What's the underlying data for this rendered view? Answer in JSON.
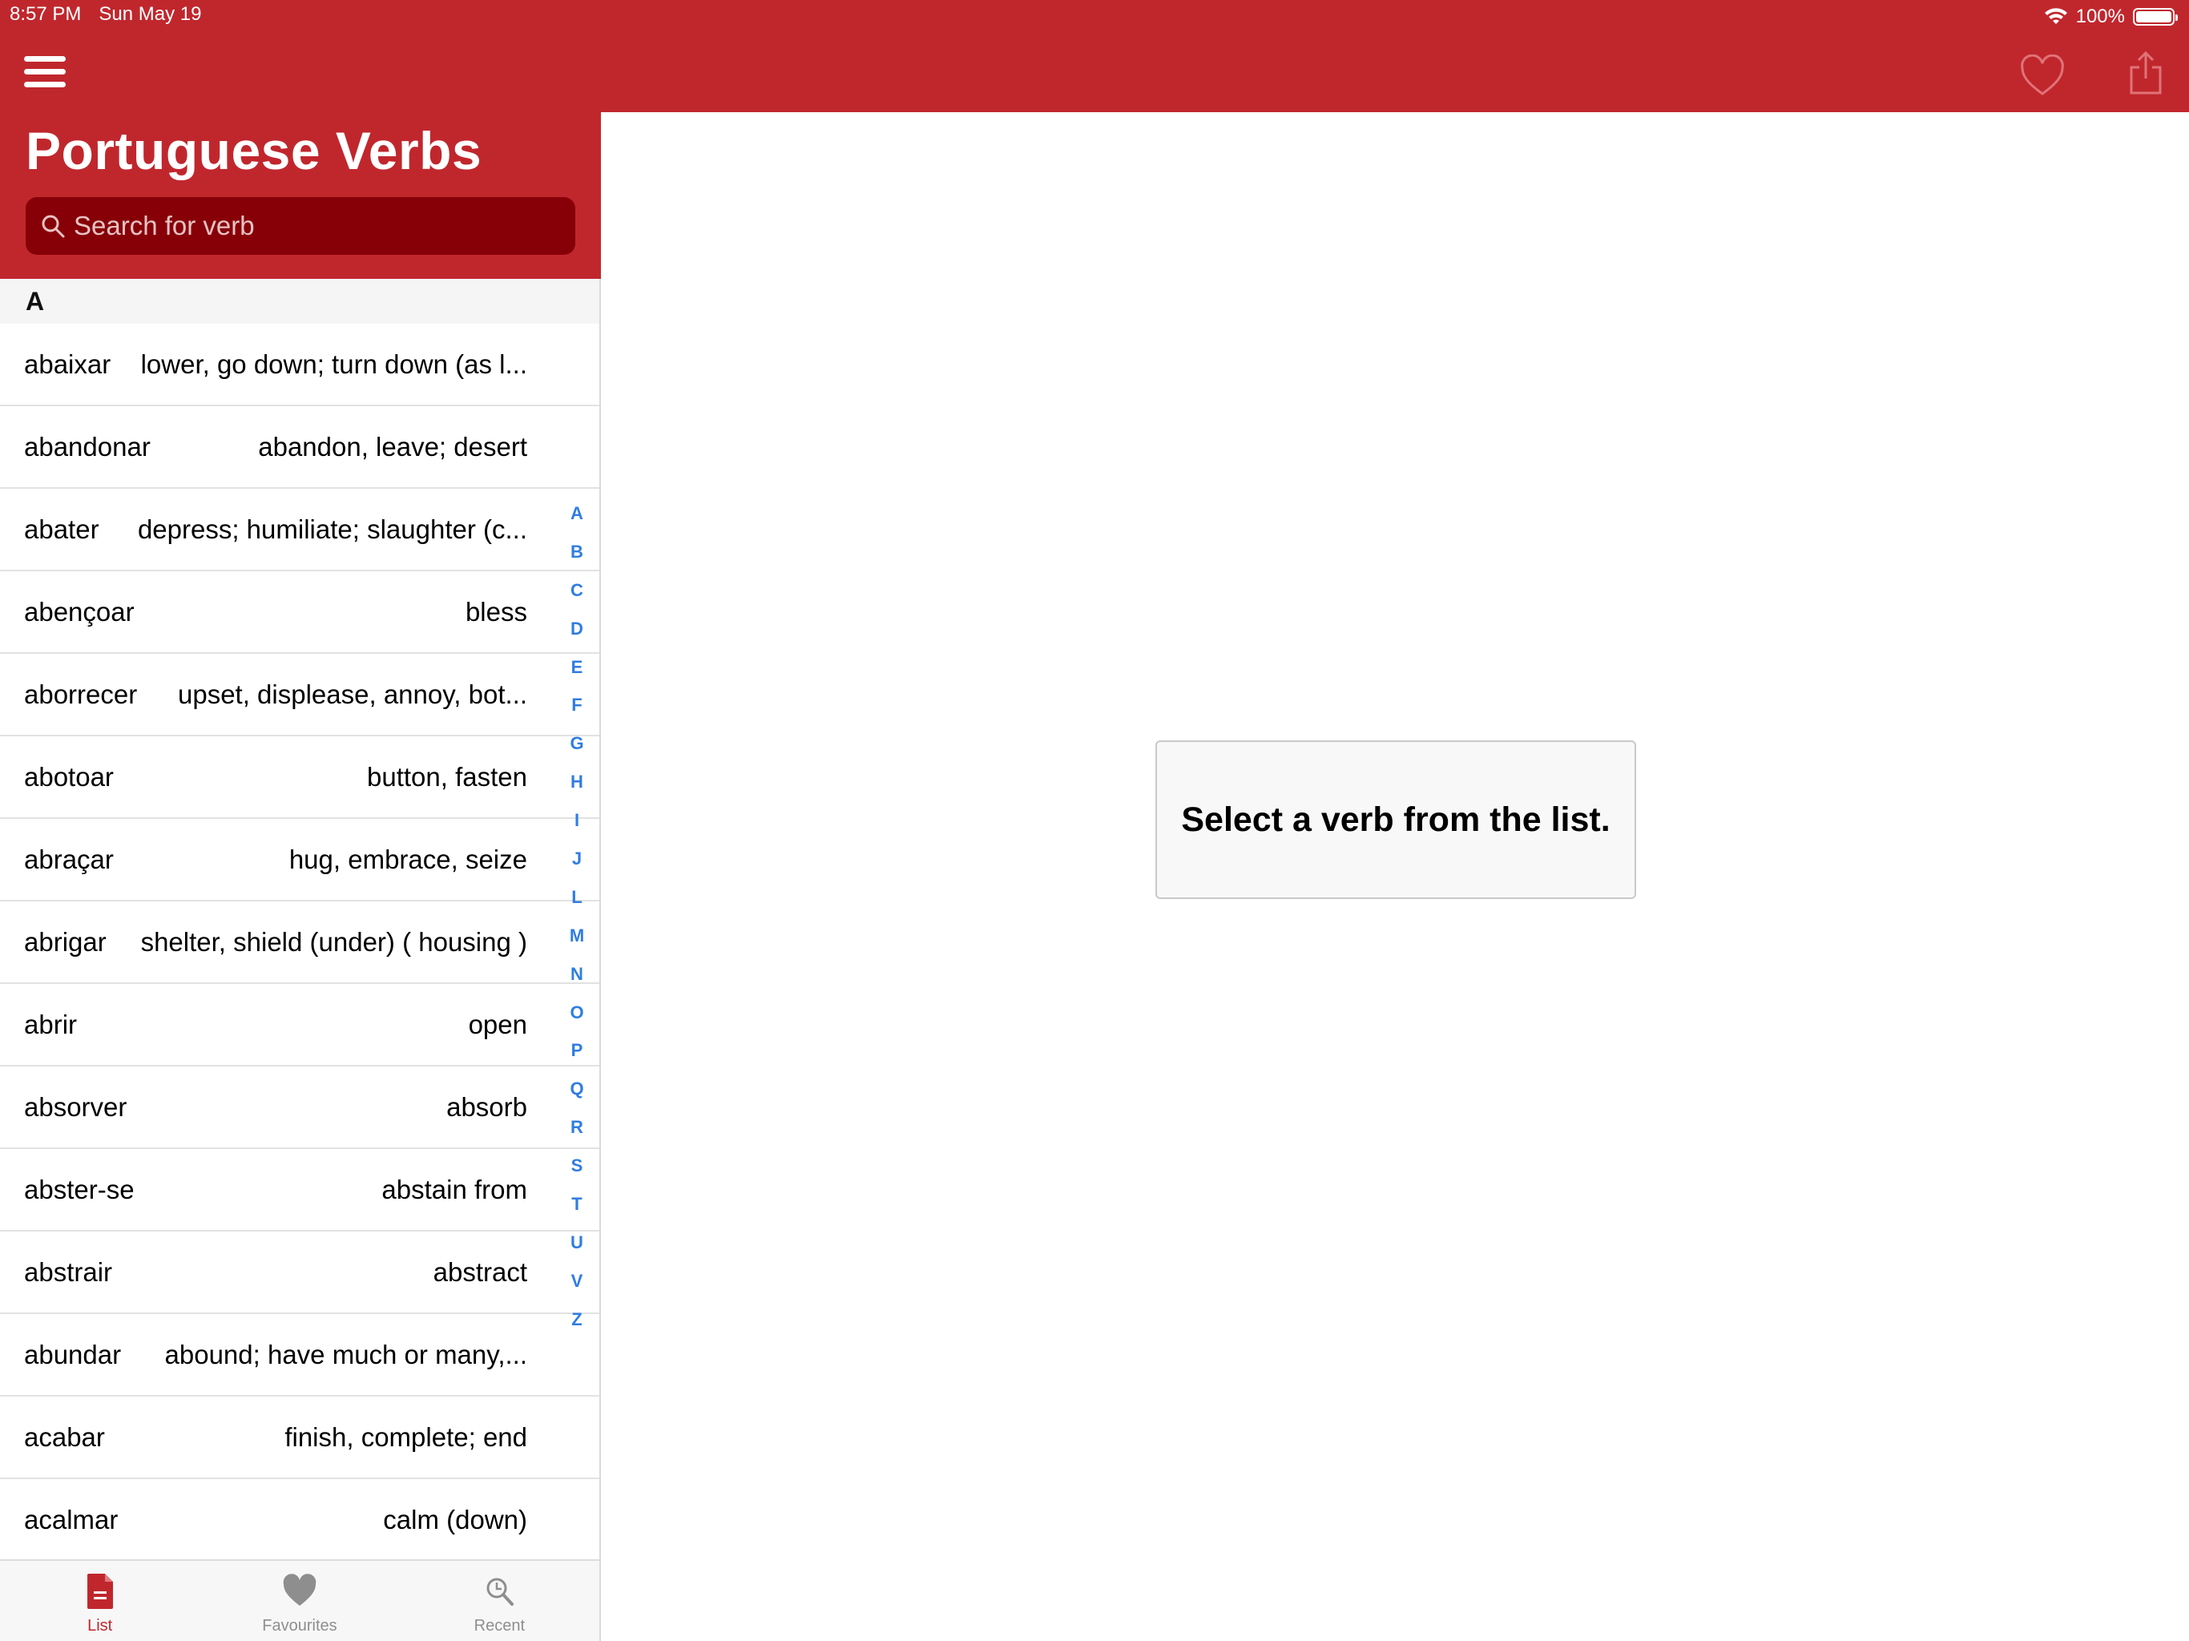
{
  "status_bar": {
    "time": "8:57 PM",
    "date": "Sun May 19",
    "battery": "100%"
  },
  "sidebar": {
    "title": "Portuguese Verbs",
    "search": {
      "placeholder": "Search for verb"
    },
    "section_letter": "A",
    "verbs": [
      {
        "verb": "abaixar",
        "meaning": "lower, go down; turn down (as l..."
      },
      {
        "verb": "abandonar",
        "meaning": "abandon, leave; desert"
      },
      {
        "verb": "abater",
        "meaning": "depress; humiliate; slaughter (c..."
      },
      {
        "verb": "abençoar",
        "meaning": "bless"
      },
      {
        "verb": "aborrecer",
        "meaning": "upset, displease, annoy, bot..."
      },
      {
        "verb": "abotoar",
        "meaning": "button, fasten"
      },
      {
        "verb": "abraçar",
        "meaning": "hug, embrace, seize"
      },
      {
        "verb": "abrigar",
        "meaning": "shelter, shield (under) ( housing )"
      },
      {
        "verb": "abrir",
        "meaning": "open"
      },
      {
        "verb": "absorver",
        "meaning": "absorb"
      },
      {
        "verb": "abster-se",
        "meaning": "abstain from"
      },
      {
        "verb": "abstrair",
        "meaning": "abstract"
      },
      {
        "verb": "abundar",
        "meaning": "abound; have much or many,..."
      },
      {
        "verb": "acabar",
        "meaning": "finish, complete; end"
      },
      {
        "verb": "acalmar",
        "meaning": "calm (down)"
      }
    ],
    "index_letters": [
      "A",
      "B",
      "C",
      "D",
      "E",
      "F",
      "G",
      "H",
      "I",
      "J",
      "L",
      "M",
      "N",
      "O",
      "P",
      "Q",
      "R",
      "S",
      "T",
      "U",
      "V",
      "Z"
    ]
  },
  "tabs": [
    {
      "label": "List",
      "icon": "document-icon",
      "active": true
    },
    {
      "label": "Favourites",
      "icon": "heart-icon",
      "active": false
    },
    {
      "label": "Recent",
      "icon": "recent-search-icon",
      "active": false
    }
  ],
  "detail": {
    "placeholder": "Select a verb from the list.",
    "actions": {
      "favourite_icon": "heart-outline-icon",
      "share_icon": "share-icon"
    }
  },
  "colors": {
    "brand_red": "#c0272d",
    "search_bg": "#870008",
    "index_blue": "#2f7de1"
  }
}
